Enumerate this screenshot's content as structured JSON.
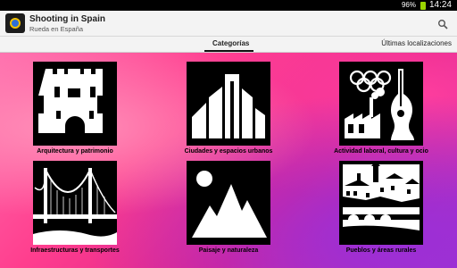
{
  "status_bar": {
    "battery": "96%",
    "time": "14:24"
  },
  "app": {
    "title": "Shooting in Spain",
    "subtitle": "Rueda en España"
  },
  "tabs": [
    {
      "label": "Categorías",
      "selected": true
    },
    {
      "label": "Últimas localizaciones",
      "selected": false
    }
  ],
  "categories": [
    {
      "label": "Arquitectura y patrimonio",
      "icon": "castle-icon"
    },
    {
      "label": "Ciudades y espacios urbanos",
      "icon": "city-buildings-icon"
    },
    {
      "label": "Actividad laboral, cultura y ocio",
      "icon": "olympic-guitar-factory-icon"
    },
    {
      "label": "Infraestructuras y transportes",
      "icon": "bridge-icon"
    },
    {
      "label": "Paisaje y naturaleza",
      "icon": "mountains-sun-icon"
    },
    {
      "label": "Pueblos y áreas rurales",
      "icon": "village-icon"
    }
  ],
  "colors": {
    "accent": "#000000",
    "background_pink": "#ff4fa0",
    "background_purple": "#9a2fd8"
  }
}
